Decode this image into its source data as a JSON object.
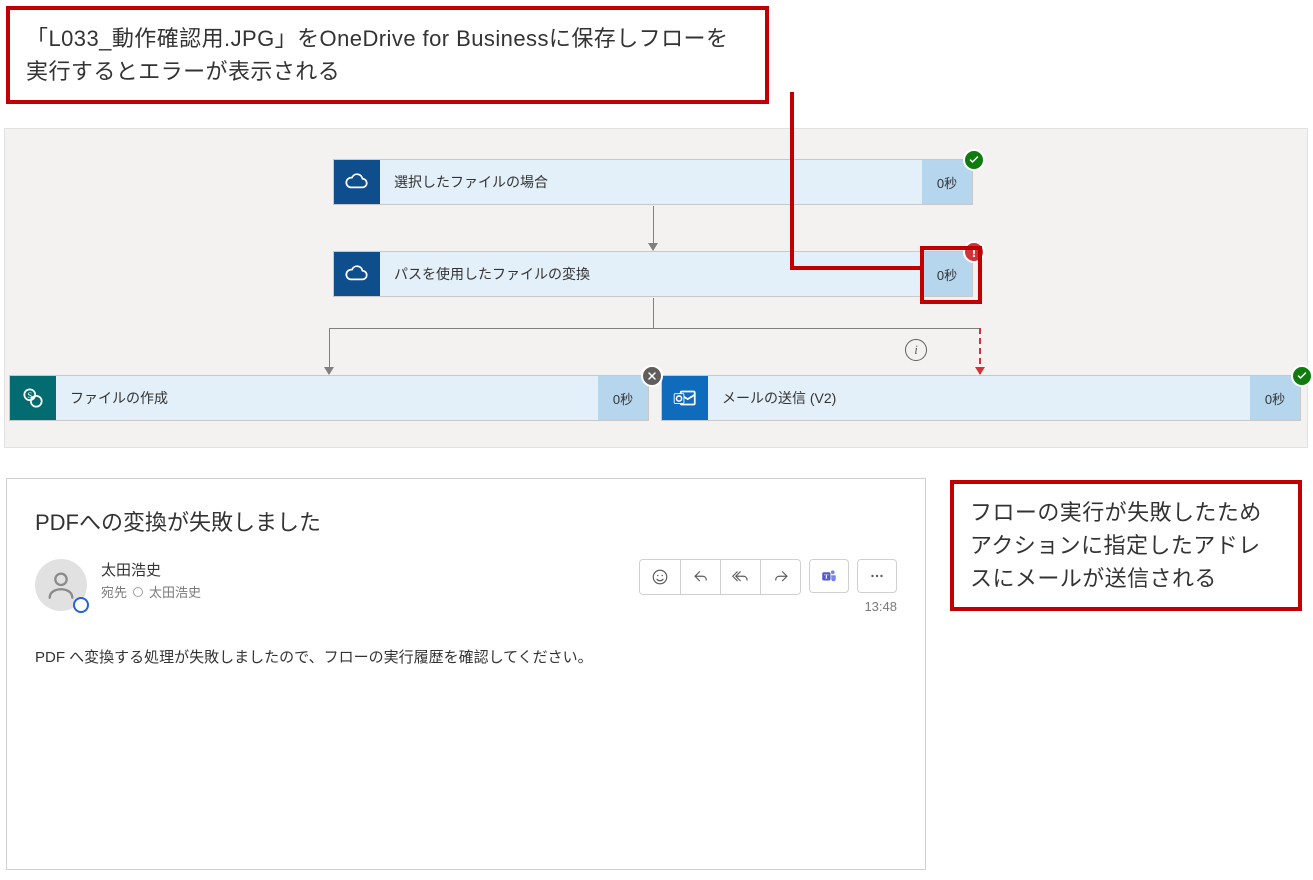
{
  "callouts": {
    "top": "「L033_動作確認用.JPG」をOneDrive for Businessに保存しフローを実行するとエラーが表示される",
    "right": "フローの実行が失敗したためアクションに指定したアドレスにメールが送信される"
  },
  "flow": {
    "step1": {
      "label": "選択したファイルの場合",
      "duration": "0秒",
      "status": "success"
    },
    "step2": {
      "label": "パスを使用したファイルの変換",
      "duration": "0秒",
      "status": "error"
    },
    "step3": {
      "label": "ファイルの作成",
      "duration": "0秒",
      "status": "cancelled"
    },
    "step4": {
      "label": "メールの送信 (V2)",
      "duration": "0秒",
      "status": "success"
    }
  },
  "email": {
    "subject": "PDFへの変換が失敗しました",
    "sender": "太田浩史",
    "recipient_label": "宛先",
    "recipient_name": "太田浩史",
    "time": "13:48",
    "body": "PDF へ変換する処理が失敗しましたので、フローの実行履歴を確認してください。"
  }
}
